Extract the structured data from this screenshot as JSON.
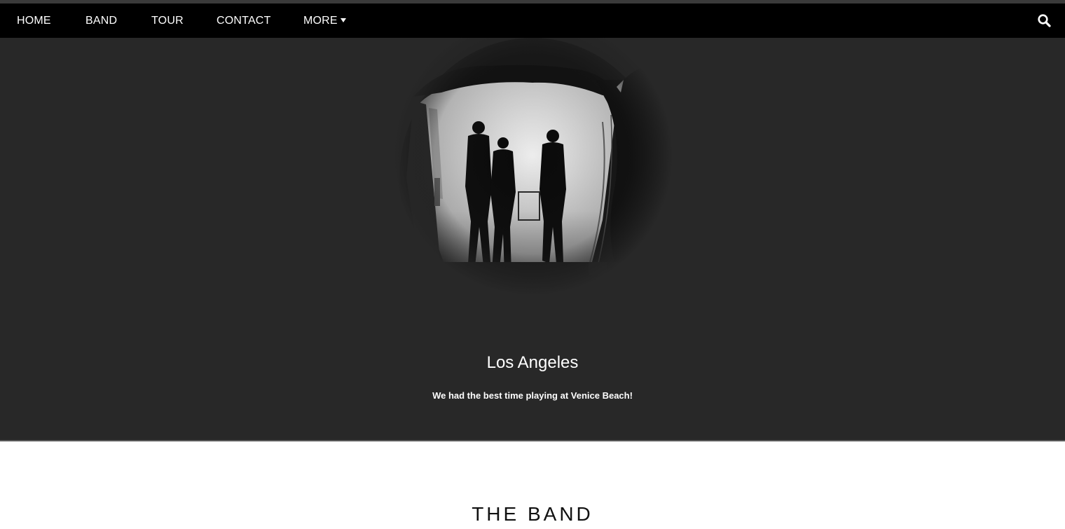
{
  "nav": {
    "items": [
      {
        "label": "HOME"
      },
      {
        "label": "BAND"
      },
      {
        "label": "TOUR"
      },
      {
        "label": "CONTACT"
      },
      {
        "label": "MORE"
      }
    ],
    "more_icon": "caret-down-icon",
    "search_icon": "search-icon"
  },
  "hero": {
    "title": "Los Angeles",
    "text": "We had the best time playing at Venice Beach!"
  },
  "band_section": {
    "title": "THE BAND"
  },
  "colors": {
    "nav_bg": "#000000",
    "hero_bg": "#282828",
    "text_light": "#ffffff",
    "text_dark": "#111111"
  }
}
